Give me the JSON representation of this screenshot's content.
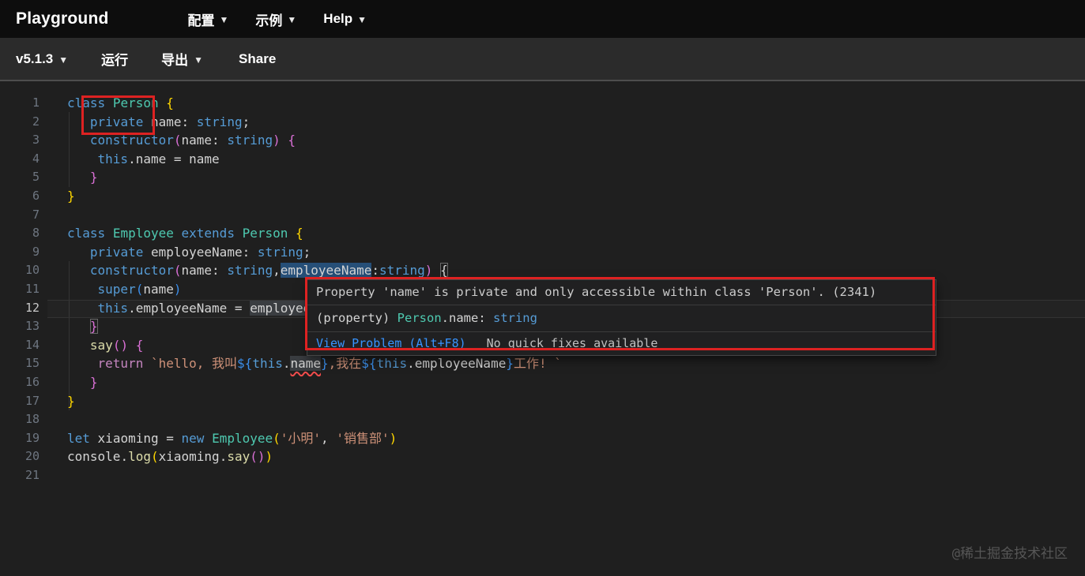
{
  "header": {
    "title": "Playground",
    "menus": [
      {
        "label": "配置",
        "caret": true
      },
      {
        "label": "示例",
        "caret": true
      },
      {
        "label": "Help",
        "caret": true
      }
    ]
  },
  "toolbar": {
    "items": [
      {
        "label": "v5.1.3",
        "caret": true
      },
      {
        "label": "运行",
        "caret": false
      },
      {
        "label": "导出",
        "caret": true
      },
      {
        "label": "Share",
        "caret": false
      }
    ]
  },
  "editor": {
    "language": "typescript",
    "active_line": 12,
    "colors": {
      "kw": "#569cd6",
      "cls": "#4ec9b0",
      "str": "#ce9178",
      "id": "#d4d4d4",
      "pl": "#d4d4d4",
      "fn": "#dcdcaa",
      "ctrl": "#c586c0",
      "b1": "#ffd700",
      "b2": "#da70d6",
      "b3": "#3b8eea",
      "error_squiggle": "#f14c4c",
      "word_highlight_blue": "#264f78",
      "word_highlight_grey": "#3a3d41",
      "annotation_red": "#dd2222"
    },
    "lines": [
      {
        "n": 1,
        "tokens": [
          {
            "t": "class",
            "c": "kw"
          },
          {
            "t": " ",
            "c": "pl"
          },
          {
            "t": "Person",
            "c": "cls"
          },
          {
            "t": " ",
            "c": "pl"
          },
          {
            "t": "{",
            "c": "b1"
          }
        ]
      },
      {
        "n": 2,
        "tokens": [
          {
            "t": "   ",
            "c": "pl"
          },
          {
            "t": "private",
            "c": "kw"
          },
          {
            "t": " ",
            "c": "pl"
          },
          {
            "t": "name",
            "c": "id"
          },
          {
            "t": ": ",
            "c": "pl"
          },
          {
            "t": "string",
            "c": "kw"
          },
          {
            "t": ";",
            "c": "pl"
          }
        ]
      },
      {
        "n": 3,
        "tokens": [
          {
            "t": "   ",
            "c": "pl"
          },
          {
            "t": "constructor",
            "c": "kw"
          },
          {
            "t": "(",
            "c": "b2"
          },
          {
            "t": "name",
            "c": "id"
          },
          {
            "t": ": ",
            "c": "pl"
          },
          {
            "t": "string",
            "c": "kw"
          },
          {
            "t": ")",
            "c": "b2"
          },
          {
            "t": " ",
            "c": "pl"
          },
          {
            "t": "{",
            "c": "b2"
          }
        ]
      },
      {
        "n": 4,
        "tokens": [
          {
            "t": "    ",
            "c": "pl"
          },
          {
            "t": "this",
            "c": "kw"
          },
          {
            "t": ".",
            "c": "pl"
          },
          {
            "t": "name",
            "c": "id"
          },
          {
            "t": " = ",
            "c": "pl"
          },
          {
            "t": "name",
            "c": "id"
          }
        ]
      },
      {
        "n": 5,
        "tokens": [
          {
            "t": "   ",
            "c": "pl"
          },
          {
            "t": "}",
            "c": "b2"
          }
        ]
      },
      {
        "n": 6,
        "tokens": [
          {
            "t": "}",
            "c": "b1"
          }
        ]
      },
      {
        "n": 7,
        "tokens": []
      },
      {
        "n": 8,
        "tokens": [
          {
            "t": "class",
            "c": "kw"
          },
          {
            "t": " ",
            "c": "pl"
          },
          {
            "t": "Employee",
            "c": "cls"
          },
          {
            "t": " ",
            "c": "pl"
          },
          {
            "t": "extends",
            "c": "kw"
          },
          {
            "t": " ",
            "c": "pl"
          },
          {
            "t": "Person",
            "c": "cls"
          },
          {
            "t": " ",
            "c": "pl"
          },
          {
            "t": "{",
            "c": "b1"
          }
        ]
      },
      {
        "n": 9,
        "tokens": [
          {
            "t": "   ",
            "c": "pl"
          },
          {
            "t": "private",
            "c": "kw"
          },
          {
            "t": " ",
            "c": "pl"
          },
          {
            "t": "employeeName",
            "c": "id"
          },
          {
            "t": ": ",
            "c": "pl"
          },
          {
            "t": "string",
            "c": "kw"
          },
          {
            "t": ";",
            "c": "pl"
          }
        ]
      },
      {
        "n": 10,
        "tokens": [
          {
            "t": "   ",
            "c": "pl"
          },
          {
            "t": "constructor",
            "c": "kw"
          },
          {
            "t": "(",
            "c": "b2"
          },
          {
            "t": "name",
            "c": "id"
          },
          {
            "t": ": ",
            "c": "pl"
          },
          {
            "t": "string",
            "c": "kw"
          },
          {
            "t": ",",
            "c": "pl"
          },
          {
            "t": "employeeName",
            "c": "id",
            "bg": "blue"
          },
          {
            "t": ":",
            "c": "pl"
          },
          {
            "t": "string",
            "c": "kw"
          },
          {
            "t": ")",
            "c": "b2"
          },
          {
            "t": " ",
            "c": "pl"
          },
          {
            "t": "{",
            "c": "pl",
            "box": true
          }
        ]
      },
      {
        "n": 11,
        "tokens": [
          {
            "t": "    ",
            "c": "pl"
          },
          {
            "t": "super",
            "c": "kw"
          },
          {
            "t": "(",
            "c": "b3"
          },
          {
            "t": "name",
            "c": "id"
          },
          {
            "t": ")",
            "c": "b3"
          }
        ]
      },
      {
        "n": 12,
        "tokens": [
          {
            "t": "    ",
            "c": "pl"
          },
          {
            "t": "this",
            "c": "kw"
          },
          {
            "t": ".",
            "c": "pl"
          },
          {
            "t": "employeeName",
            "c": "id"
          },
          {
            "t": " = ",
            "c": "pl"
          },
          {
            "t": "employeeName",
            "c": "id",
            "bg": "grey"
          }
        ]
      },
      {
        "n": 13,
        "tokens": [
          {
            "t": "   ",
            "c": "pl"
          },
          {
            "t": "}",
            "c": "b2",
            "box": true
          }
        ]
      },
      {
        "n": 14,
        "tokens": [
          {
            "t": "   ",
            "c": "pl"
          },
          {
            "t": "say",
            "c": "fn"
          },
          {
            "t": "(",
            "c": "b2"
          },
          {
            "t": ")",
            "c": "b2"
          },
          {
            "t": " ",
            "c": "pl"
          },
          {
            "t": "{",
            "c": "b2"
          }
        ]
      },
      {
        "n": 15,
        "tokens": [
          {
            "t": "    ",
            "c": "pl"
          },
          {
            "t": "return",
            "c": "ctrl"
          },
          {
            "t": " ",
            "c": "pl"
          },
          {
            "t": "`hello, 我叫",
            "c": "str"
          },
          {
            "t": "${",
            "c": "b3"
          },
          {
            "t": "this",
            "c": "kw"
          },
          {
            "t": ".",
            "c": "pl"
          },
          {
            "t": "name",
            "c": "id",
            "bg": "grey",
            "sq": true
          },
          {
            "t": "}",
            "c": "b3"
          },
          {
            "t": ",我在",
            "c": "str"
          },
          {
            "t": "${",
            "c": "b3"
          },
          {
            "t": "this",
            "c": "kw"
          },
          {
            "t": ".",
            "c": "pl"
          },
          {
            "t": "employeeName",
            "c": "id"
          },
          {
            "t": "}",
            "c": "b3"
          },
          {
            "t": "工作! `",
            "c": "str"
          }
        ]
      },
      {
        "n": 16,
        "tokens": [
          {
            "t": "   ",
            "c": "pl"
          },
          {
            "t": "}",
            "c": "b2"
          }
        ]
      },
      {
        "n": 17,
        "tokens": [
          {
            "t": "}",
            "c": "b1"
          }
        ]
      },
      {
        "n": 18,
        "tokens": []
      },
      {
        "n": 19,
        "tokens": [
          {
            "t": "let",
            "c": "kw"
          },
          {
            "t": " ",
            "c": "pl"
          },
          {
            "t": "xiaoming",
            "c": "id"
          },
          {
            "t": " = ",
            "c": "pl"
          },
          {
            "t": "new",
            "c": "kw"
          },
          {
            "t": " ",
            "c": "pl"
          },
          {
            "t": "Employee",
            "c": "cls"
          },
          {
            "t": "(",
            "c": "b1"
          },
          {
            "t": "'小明'",
            "c": "str"
          },
          {
            "t": ", ",
            "c": "pl"
          },
          {
            "t": "'销售部'",
            "c": "str"
          },
          {
            "t": ")",
            "c": "b1"
          }
        ]
      },
      {
        "n": 20,
        "tokens": [
          {
            "t": "console",
            "c": "id"
          },
          {
            "t": ".",
            "c": "pl"
          },
          {
            "t": "log",
            "c": "fn"
          },
          {
            "t": "(",
            "c": "b1"
          },
          {
            "t": "xiaoming",
            "c": "id"
          },
          {
            "t": ".",
            "c": "pl"
          },
          {
            "t": "say",
            "c": "fn"
          },
          {
            "t": "(",
            "c": "b2"
          },
          {
            "t": ")",
            "c": "b2"
          },
          {
            "t": ")",
            "c": "b1"
          }
        ]
      },
      {
        "n": 21,
        "tokens": []
      }
    ],
    "tooltip": {
      "message": "Property 'name' is private and only accessible within class 'Person'. (2341)",
      "signature": [
        {
          "t": "(property) ",
          "c": "pl"
        },
        {
          "t": "Person",
          "c": "cls"
        },
        {
          "t": ".name: ",
          "c": "pl"
        },
        {
          "t": "string",
          "c": "kw"
        }
      ],
      "link_label": "View Problem (Alt+F8)",
      "status_label": "No quick fixes available"
    }
  },
  "watermark": "@稀土掘金技术社区"
}
